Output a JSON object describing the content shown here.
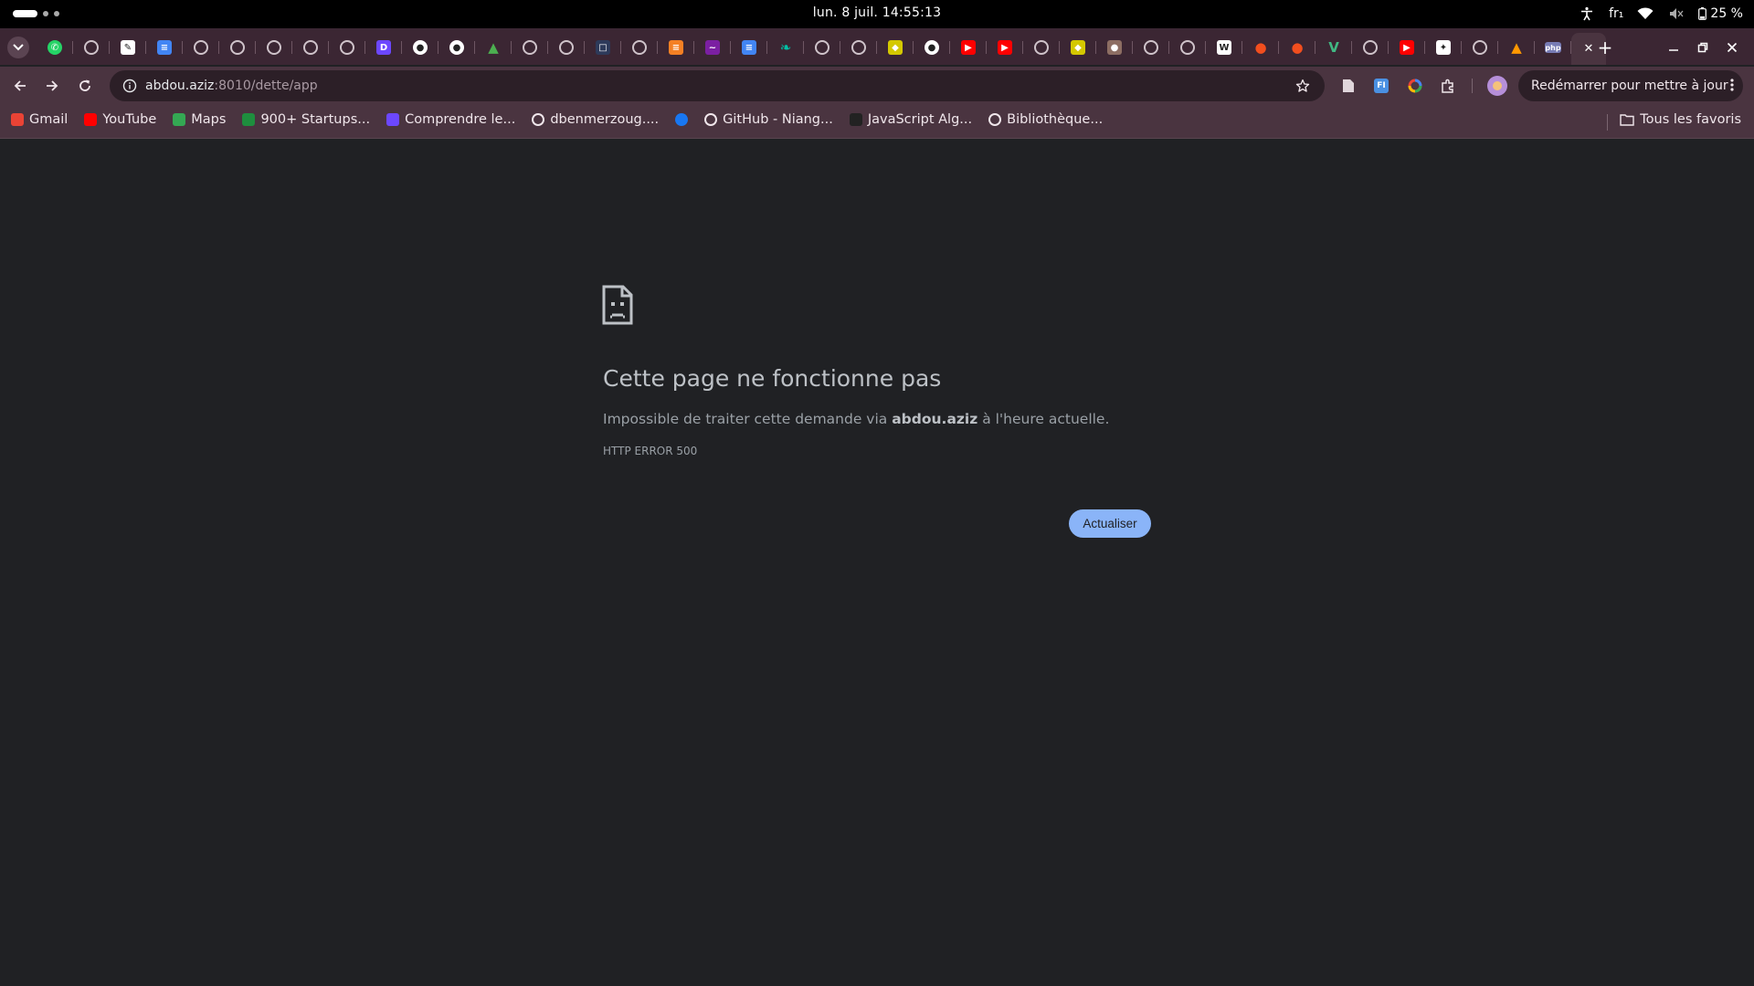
{
  "system_bar": {
    "clock": "lun. 8 juil.  14:55:13",
    "keyboard_layout": "fr₁",
    "battery": "25 %"
  },
  "tabs": [
    {
      "icon": "whatsapp-icon",
      "color": "#25D366"
    },
    {
      "icon": "globe-icon"
    },
    {
      "icon": "notepad-icon",
      "color": "#ffffff"
    },
    {
      "icon": "google-docs-icon",
      "color": "#4285F4"
    },
    {
      "icon": "globe-icon"
    },
    {
      "icon": "globe-icon"
    },
    {
      "icon": "globe-icon"
    },
    {
      "icon": "globe-icon"
    },
    {
      "icon": "globe-icon"
    },
    {
      "icon": "dev-icon",
      "color": "#6c47ff"
    },
    {
      "icon": "github-icon"
    },
    {
      "icon": "github-icon"
    },
    {
      "icon": "green-app-icon",
      "color": "#4caf50"
    },
    {
      "icon": "globe-icon"
    },
    {
      "icon": "globe-icon"
    },
    {
      "icon": "dark-square-icon",
      "color": "#2d3a5a"
    },
    {
      "icon": "globe-icon"
    },
    {
      "icon": "orange-stack-icon",
      "color": "#f48024"
    },
    {
      "icon": "purple-wave-icon",
      "color": "#7b1fa2"
    },
    {
      "icon": "google-docs-icon",
      "color": "#4285F4"
    },
    {
      "icon": "leaf-icon",
      "color": "#00bfa5"
    },
    {
      "icon": "globe-icon"
    },
    {
      "icon": "globe-icon"
    },
    {
      "icon": "shield-icon",
      "color": "#d4c800"
    },
    {
      "icon": "github-icon"
    },
    {
      "icon": "youtube-icon",
      "color": "#FF0000"
    },
    {
      "icon": "youtube-icon",
      "color": "#FF0000"
    },
    {
      "icon": "globe-icon"
    },
    {
      "icon": "shield-icon",
      "color": "#d4c800"
    },
    {
      "icon": "mascot-icon",
      "color": "#8d6e63"
    },
    {
      "icon": "globe-icon"
    },
    {
      "icon": "globe-icon"
    },
    {
      "icon": "wikipedia-icon",
      "color": "#ffffff"
    },
    {
      "icon": "figma-icon",
      "color": "#F24E1E"
    },
    {
      "icon": "figma-icon",
      "color": "#F24E1E"
    },
    {
      "icon": "vue-icon",
      "color": "#41B883"
    },
    {
      "icon": "globe-icon"
    },
    {
      "icon": "youtube-icon",
      "color": "#FF0000"
    },
    {
      "icon": "openai-icon",
      "color": "#ffffff"
    },
    {
      "icon": "globe-icon"
    },
    {
      "icon": "warning-cone-icon",
      "color": "#ff9800"
    },
    {
      "icon": "php-icon",
      "color": "#777BB4",
      "label": "php"
    }
  ],
  "active_tab_close": "✕",
  "new_tab": "+",
  "omnibox": {
    "host": "abdou.aziz",
    "rest": ":8010/dette/app"
  },
  "update_button": "Redémarrer pour mettre à jour",
  "bookmarks": [
    {
      "label": "Gmail",
      "icon": "gmail-icon",
      "color": "#EA4335"
    },
    {
      "label": "YouTube",
      "icon": "youtube-icon",
      "color": "#FF0000"
    },
    {
      "label": "Maps",
      "icon": "maps-icon",
      "color": "#34A853"
    },
    {
      "label": "900+ Startups...",
      "icon": "startups-icon",
      "color": "#1e8e3e"
    },
    {
      "label": "Comprendre le...",
      "icon": "dev-icon",
      "color": "#6c47ff"
    },
    {
      "label": "dbenmerzoug....",
      "icon": "globe-icon"
    },
    {
      "label": "",
      "icon": "facebook-icon",
      "color": "#1877F2"
    },
    {
      "label": "GitHub - Niang...",
      "icon": "github-icon"
    },
    {
      "label": "JavaScript Alg...",
      "icon": "js-algo-icon",
      "color": "#222"
    },
    {
      "label": "Bibliothèque...",
      "icon": "globe-icon"
    }
  ],
  "all_bookmarks": "Tous les favoris",
  "error": {
    "title": "Cette page ne fonctionne pas",
    "desc_before": "Impossible de traiter cette demande via ",
    "desc_host": "abdou.aziz",
    "desc_after": " à l'heure actuelle.",
    "code": "HTTP ERROR 500",
    "reload": "Actualiser"
  }
}
